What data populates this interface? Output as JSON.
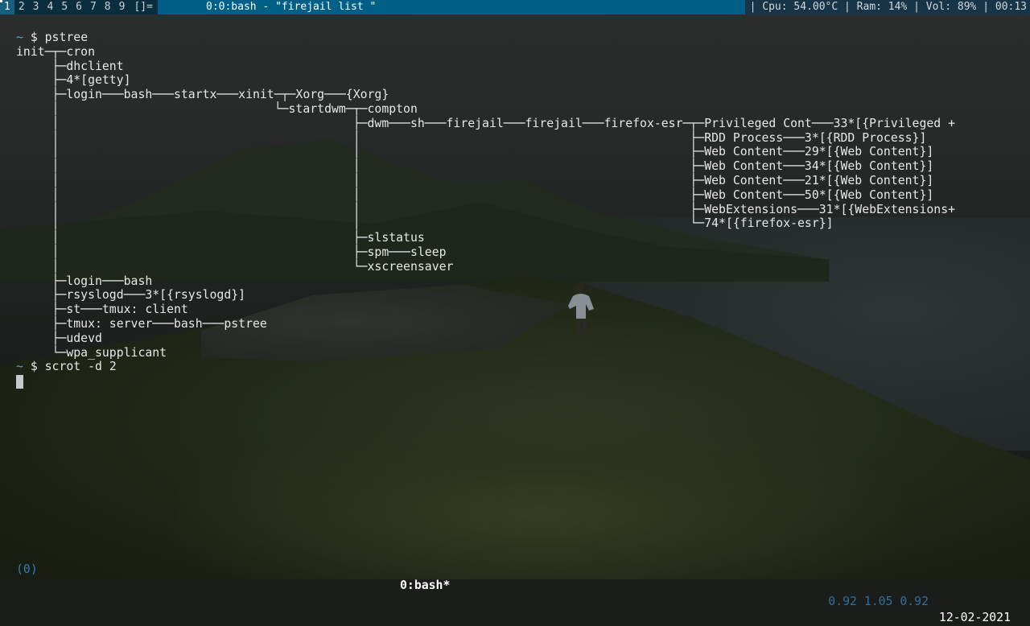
{
  "topbar": {
    "workspaces": [
      "1",
      "2",
      "3",
      "4",
      "5",
      "6",
      "7",
      "8",
      "9"
    ],
    "active_workspace": "1",
    "layout_symbol": "[]=",
    "window_title": "0:0:bash - \"firejail list \"",
    "status": "| Cpu: 54.00°C | Ram: 14% | Vol: 89% | 00:13"
  },
  "terminal": {
    "lines": [
      "~ $ pstree",
      "init─┬─cron",
      "     ├─dhclient",
      "     ├─4*[getty]",
      "     ├─login───bash───startx───xinit─┬─Xorg───{Xorg}",
      "     │                              └─startdwm─┬─compton",
      "     │                                         ├─dwm───sh───firejail───firejail───firefox-esr─┬─Privileged Cont───33*[{Privileged +",
      "     │                                         │                                              ├─RDD Process───3*[{RDD Process}]",
      "     │                                         │                                              ├─Web Content───29*[{Web Content}]",
      "     │                                         │                                              ├─Web Content───34*[{Web Content}]",
      "     │                                         │                                              ├─Web Content───21*[{Web Content}]",
      "     │                                         │                                              ├─Web Content───50*[{Web Content}]",
      "     │                                         │                                              ├─WebExtensions───31*[{WebExtensions+",
      "     │                                         │                                              └─74*[{firefox-esr}]",
      "     │                                         ├─slstatus",
      "     │                                         ├─spm───sleep",
      "     │                                         └─xscreensaver",
      "     ├─login───bash",
      "     ├─rsyslogd───3*[{rsyslogd}]",
      "     ├─st───tmux: client",
      "     ├─tmux: server───bash───pstree",
      "     ├─udevd",
      "     └─wpa_supplicant",
      "~ $ scrot -d 2"
    ],
    "prompt_symbol": "~"
  },
  "bottombar": {
    "session": "(0)",
    "window": "0:bash*",
    "loadavg": "0.92 1.05 0.92",
    "date": "12-02-2021"
  },
  "colors": {
    "topbar_bg": "#005f87",
    "prompt": "#4ea6d7",
    "loadavg": "#2e6f9e"
  }
}
